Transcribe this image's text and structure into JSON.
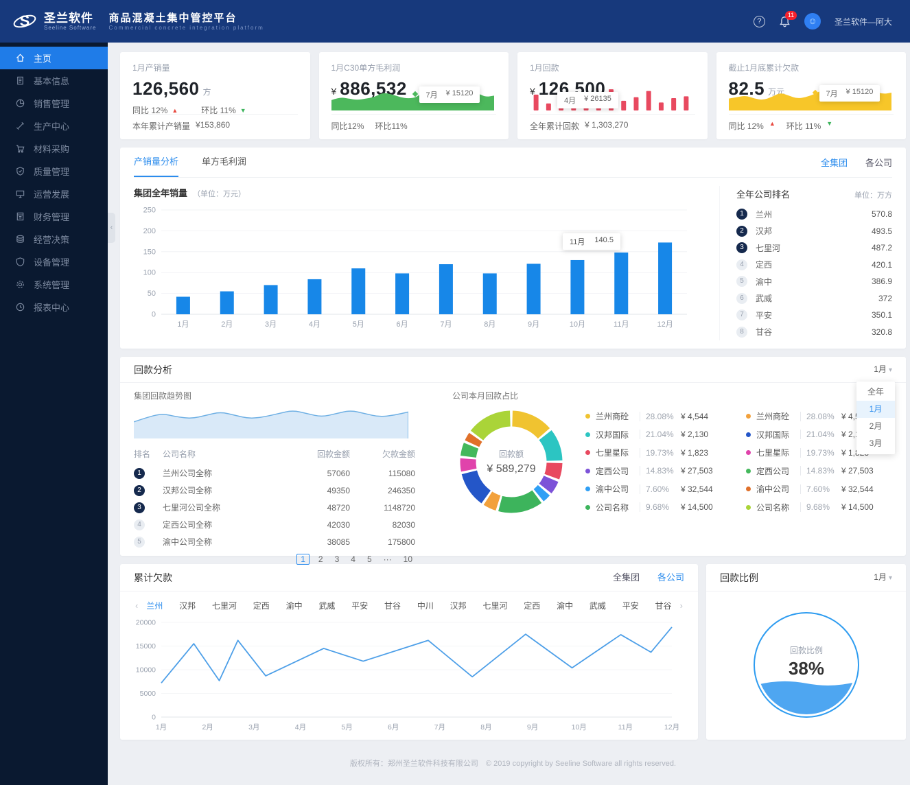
{
  "header": {
    "logo_title": "圣兰软件",
    "logo_subtitle": "Seeline Software",
    "app_title": "商品混凝土集中管控平台",
    "app_subtitle": "Commercial concrete integration platform",
    "help_label": "?",
    "notification_count": "11",
    "username": "圣兰软件—阿大"
  },
  "sidebar": {
    "items": [
      {
        "label": "主页",
        "icon": "home-icon",
        "active": true
      },
      {
        "label": "基本信息",
        "icon": "document-icon",
        "active": false
      },
      {
        "label": "销售管理",
        "icon": "pie-icon",
        "active": false
      },
      {
        "label": "生产中心",
        "icon": "tools-icon",
        "active": false
      },
      {
        "label": "材料采购",
        "icon": "cart-icon",
        "active": false
      },
      {
        "label": "质量管理",
        "icon": "badge-icon",
        "active": false
      },
      {
        "label": "运营发展",
        "icon": "monitor-icon",
        "active": false
      },
      {
        "label": "财务管理",
        "icon": "ledger-icon",
        "active": false
      },
      {
        "label": "经营决策",
        "icon": "coins-icon",
        "active": false
      },
      {
        "label": "设备管理",
        "icon": "shield-icon",
        "active": false
      },
      {
        "label": "系统管理",
        "icon": "gear-icon",
        "active": false
      },
      {
        "label": "报表中心",
        "icon": "clock-icon",
        "active": false
      }
    ]
  },
  "kpi_cards": [
    {
      "label": "1月产销量",
      "value": "126,560",
      "unit": "方",
      "yoy": "同比 12%",
      "mom": "环比 11%",
      "footer_label": "本年累计产销量",
      "footer_value": "¥153,860"
    },
    {
      "label": "1月C30单方毛利润",
      "currency": "¥",
      "value": "886,532",
      "tooltip_label": "7月",
      "tooltip_value": "¥ 15120",
      "yoy": "同比12%",
      "mom": "环比11%"
    },
    {
      "label": "1月回款",
      "currency": "¥",
      "value": "126,500",
      "tooltip_label": "4月",
      "tooltip_value": "¥ 26135",
      "footer_label": "全年累计回款",
      "footer_value": "¥ 1,303,270"
    },
    {
      "label": "截止1月底累计欠款",
      "value": "82.5",
      "unit": "万元",
      "tooltip_label": "7月",
      "tooltip_value": "¥ 15120",
      "yoy": "同比 12%",
      "mom": "环比 11%"
    }
  ],
  "sales_section": {
    "tabs": [
      {
        "label": "产销量分析",
        "active": true
      },
      {
        "label": "单方毛利润",
        "active": false
      }
    ],
    "scope_tabs": [
      {
        "label": "全集团",
        "active": true
      },
      {
        "label": "各公司",
        "active": false
      }
    ],
    "chart_title": "集团全年销量",
    "chart_unit": "（单位：万元）",
    "ranking": {
      "title": "全年公司排名",
      "unit": "单位：万方",
      "items": [
        {
          "rank": "1",
          "name": "兰州",
          "value": "570.8"
        },
        {
          "rank": "2",
          "name": "汉邦",
          "value": "493.5"
        },
        {
          "rank": "3",
          "name": "七里河",
          "value": "487.2"
        },
        {
          "rank": "4",
          "name": "定西",
          "value": "420.1"
        },
        {
          "rank": "5",
          "name": "渝中",
          "value": "386.9"
        },
        {
          "rank": "6",
          "name": "武威",
          "value": "372"
        },
        {
          "rank": "7",
          "name": "平安",
          "value": "350.1"
        },
        {
          "rank": "8",
          "name": "甘谷",
          "value": "320.8"
        }
      ]
    }
  },
  "collection_section": {
    "title": "回款分析",
    "period_selected": "1月",
    "period_options": [
      {
        "label": "全年",
        "selected": false
      },
      {
        "label": "1月",
        "selected": true
      },
      {
        "label": "2月",
        "selected": false
      },
      {
        "label": "3月",
        "selected": false
      }
    ],
    "trend_title": "集团回款趋势图",
    "table": {
      "headers": [
        "排名",
        "公司名称",
        "回款金额",
        "欠款金额"
      ],
      "rows": [
        {
          "rank": "1",
          "name": "兰州公司全称",
          "amount": "57060",
          "debt": "115080"
        },
        {
          "rank": "2",
          "name": "汉邦公司全称",
          "amount": "49350",
          "debt": "246350"
        },
        {
          "rank": "3",
          "name": "七里河公司全称",
          "amount": "48720",
          "debt": "1148720"
        },
        {
          "rank": "4",
          "name": "定西公司全称",
          "amount": "42030",
          "debt": "82030"
        },
        {
          "rank": "5",
          "name": "渝中公司全称",
          "amount": "38085",
          "debt": "175800"
        }
      ],
      "pages": [
        "1",
        "2",
        "3",
        "4",
        "5",
        "···",
        "10"
      ],
      "current_page": "1"
    },
    "donut_title": "公司本月回款占比",
    "donut_center_label": "回款额",
    "donut_center_value": "¥ 589,279",
    "legend_col1": [
      {
        "name": "兰州商砼",
        "pct": "28.08%",
        "amount": "¥ 4,544",
        "color": "#f0c330"
      },
      {
        "name": "汉邦国际",
        "pct": "21.04%",
        "amount": "¥ 2,130",
        "color": "#2cc5c2"
      },
      {
        "name": "七里星际",
        "pct": "19.73%",
        "amount": "¥ 1,823",
        "color": "#e8495f"
      },
      {
        "name": "定西公司",
        "pct": "14.83%",
        "amount": "¥ 27,503",
        "color": "#7c52d8"
      },
      {
        "name": "渝中公司",
        "pct": "7.60%",
        "amount": "¥ 32,544",
        "color": "#2f9ff5"
      },
      {
        "name": "公司名称",
        "pct": "9.68%",
        "amount": "¥ 14,500",
        "color": "#3db45c"
      }
    ],
    "legend_col2": [
      {
        "name": "兰州商砼",
        "pct": "28.08%",
        "amount": "¥ 4,544",
        "color": "#f2a13c"
      },
      {
        "name": "汉邦国际",
        "pct": "21.04%",
        "amount": "¥ 2,130",
        "color": "#2456c8"
      },
      {
        "name": "七里星际",
        "pct": "19.73%",
        "amount": "¥ 1,823",
        "color": "#e043ab"
      },
      {
        "name": "定西公司",
        "pct": "14.83%",
        "amount": "¥ 27,503",
        "color": "#44b85c"
      },
      {
        "name": "渝中公司",
        "pct": "7.60%",
        "amount": "¥ 32,544",
        "color": "#e0702a"
      },
      {
        "name": "公司名称",
        "pct": "9.68%",
        "amount": "¥ 14,500",
        "color": "#aad438"
      }
    ]
  },
  "debt_section": {
    "title": "累计欠款",
    "scope_tabs": [
      {
        "label": "全集团",
        "active": false
      },
      {
        "label": "各公司",
        "active": true
      }
    ],
    "company_tabs": [
      "兰州",
      "汉邦",
      "七里河",
      "定西",
      "渝中",
      "武威",
      "平安",
      "甘谷",
      "中川",
      "汉邦",
      "七里河",
      "定西",
      "渝中",
      "武威",
      "平安",
      "甘谷"
    ],
    "active_company": "兰州"
  },
  "ratio_card": {
    "title": "回款比例",
    "period_selected": "1月",
    "gauge_label": "回款比例",
    "gauge_value": "38%"
  },
  "footer": {
    "text": "版权所有：郑州圣兰软件科技有限公司　© 2019 copyright by Seeline Software all rights reserved."
  },
  "chart_data": [
    {
      "id": "monthly-volume-bars",
      "type": "bar",
      "title": "集团全年销量",
      "unit": "万元",
      "categories": [
        "1月",
        "2月",
        "3月",
        "4月",
        "5月",
        "6月",
        "7月",
        "8月",
        "9月",
        "10月",
        "11月",
        "12月"
      ],
      "values": [
        42,
        55,
        70,
        84,
        110,
        98,
        120,
        98,
        121,
        130,
        148,
        172
      ],
      "ylim": [
        0,
        250
      ],
      "yticks": [
        0,
        50,
        100,
        150,
        200,
        250
      ],
      "color": "#1787e8",
      "tooltip": {
        "index": 10,
        "label": "11月",
        "value": "140.5"
      }
    },
    {
      "id": "profit-sparkline",
      "type": "area",
      "color": "#4cb85c",
      "values": [
        7,
        9,
        8,
        7,
        8,
        9,
        12,
        11,
        9,
        8,
        9,
        14,
        10,
        7,
        6,
        6,
        8,
        12,
        9,
        10
      ]
    },
    {
      "id": "collection-mini-bars",
      "type": "bar",
      "color": "#e8495f",
      "values": [
        18,
        8,
        12,
        7,
        8,
        10,
        24,
        11,
        15,
        22,
        9,
        14,
        16
      ]
    },
    {
      "id": "debt-sparkline",
      "type": "area",
      "color": "#f7c629",
      "values": [
        8,
        9,
        10,
        8,
        7,
        9,
        12,
        10,
        8,
        9,
        11,
        14,
        9,
        7,
        6,
        7,
        9,
        13,
        11,
        12
      ]
    },
    {
      "id": "collection-trend",
      "type": "area",
      "color": "#6fb0e4",
      "fill": "#d9e9f8",
      "values": [
        10,
        13,
        15,
        13,
        12,
        14,
        16,
        14,
        12,
        13,
        15,
        17,
        15,
        13,
        15,
        17,
        15,
        13,
        14,
        16
      ]
    },
    {
      "id": "collection-share-donut",
      "type": "pie",
      "center_label": "回款额",
      "center_value": "¥ 589,279",
      "segments": [
        {
          "pct": 14,
          "color": "#f0c330"
        },
        {
          "pct": 11,
          "color": "#2cc5c2"
        },
        {
          "pct": 6,
          "color": "#e8495f"
        },
        {
          "pct": 5,
          "color": "#7c52d8"
        },
        {
          "pct": 3.5,
          "color": "#2f9ff5"
        },
        {
          "pct": 15,
          "color": "#3db45c"
        },
        {
          "pct": 5,
          "color": "#f2a13c"
        },
        {
          "pct": 12,
          "color": "#2456c8"
        },
        {
          "pct": 5,
          "color": "#e043ab"
        },
        {
          "pct": 5,
          "color": "#44b85c"
        },
        {
          "pct": 3.5,
          "color": "#e0702a"
        },
        {
          "pct": 15,
          "color": "#aad438"
        }
      ]
    },
    {
      "id": "cumulative-debt-line",
      "type": "line",
      "color": "#4d9fe8",
      "categories": [
        "1月",
        "2月",
        "3月",
        "4月",
        "5月",
        "6月",
        "7月",
        "8月",
        "9月",
        "10月",
        "11月",
        "12月"
      ],
      "yticks": [
        0,
        5000,
        10000,
        15000,
        20000
      ],
      "ylim": [
        0,
        20000
      ],
      "points": [
        [
          0,
          7200
        ],
        [
          0.7,
          15500
        ],
        [
          1.25,
          7700
        ],
        [
          1.65,
          16200
        ],
        [
          2.25,
          8700
        ],
        [
          3.5,
          14500
        ],
        [
          4.35,
          11800
        ],
        [
          5.75,
          16200
        ],
        [
          6.7,
          8500
        ],
        [
          7.85,
          17500
        ],
        [
          8.85,
          10400
        ],
        [
          9.9,
          17400
        ],
        [
          10.55,
          13700
        ],
        [
          11,
          19000
        ]
      ]
    },
    {
      "id": "collection-ratio-gauge",
      "type": "gauge",
      "percent": 38,
      "label": "回款比例"
    }
  ]
}
